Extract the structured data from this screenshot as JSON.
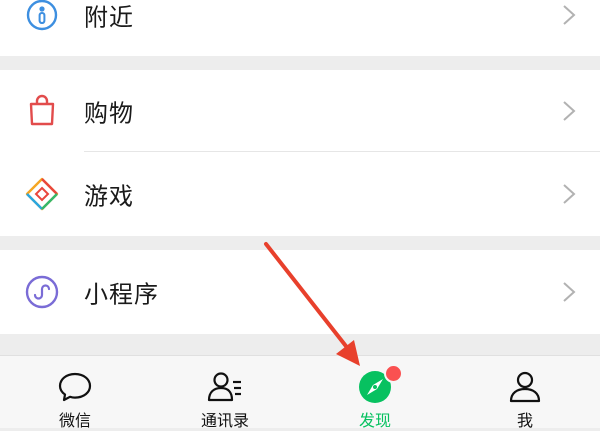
{
  "menu": {
    "nearby": {
      "label": "附近",
      "icon": "nearby-person-icon"
    },
    "shopping": {
      "label": "购物",
      "icon": "shopping-bag-icon"
    },
    "games": {
      "label": "游戏",
      "icon": "game-diamond-icon"
    },
    "miniprogram": {
      "label": "小程序",
      "icon": "mini-program-icon"
    }
  },
  "tabbar": {
    "tabs": [
      {
        "label": "微信",
        "icon": "chat-bubble-icon",
        "active": false
      },
      {
        "label": "通讯录",
        "icon": "contacts-icon",
        "active": false
      },
      {
        "label": "发现",
        "icon": "discover-compass-icon",
        "active": true,
        "badge": true
      },
      {
        "label": "我",
        "icon": "profile-icon",
        "active": false
      }
    ]
  },
  "colors": {
    "accent": "#07c160",
    "badge": "#fa5151",
    "annotation_arrow": "#e8402c"
  }
}
